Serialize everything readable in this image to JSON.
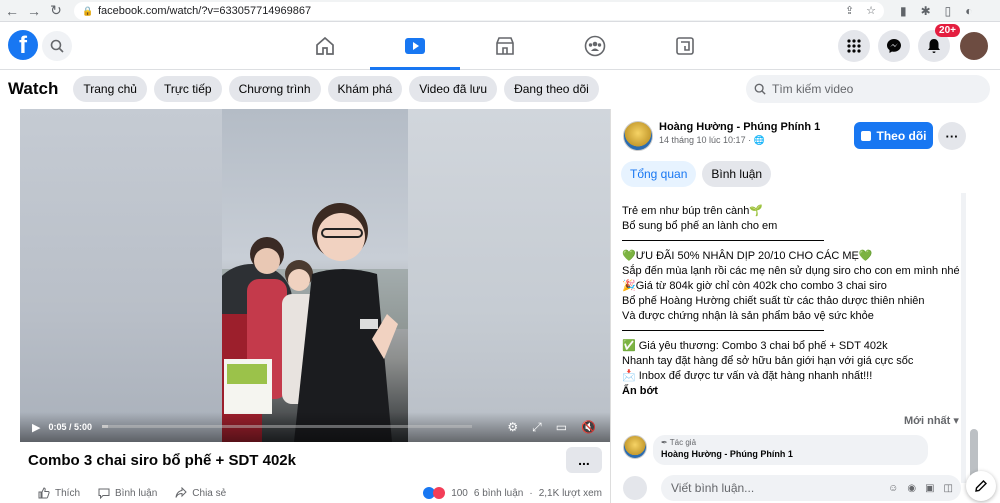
{
  "browser": {
    "url": "facebook.com/watch/?v=633057714969867"
  },
  "header": {
    "notification_badge": "20+"
  },
  "watch": {
    "title": "Watch",
    "tabs": [
      "Trang chủ",
      "Trực tiếp",
      "Chương trình",
      "Khám phá",
      "Video đã lưu",
      "Đang theo dõi"
    ],
    "search_placeholder": "Tìm kiếm video"
  },
  "video": {
    "time": "0:05 / 5:00",
    "progress": 0.017,
    "title": "Combo 3 chai siro bổ phế + SDT 402k",
    "more": "..."
  },
  "actions": {
    "like": "Thích",
    "comment": "Bình luận",
    "share": "Chia sẻ",
    "reactions": "100",
    "comments_count": "6 bình luận",
    "views": "2,1K lượt xem"
  },
  "post": {
    "author": "Hoàng Hường - Phúng Phính 1",
    "time": "14 tháng 10 lúc 10:17 · 🌐",
    "follow": "Theo dõi",
    "tabs": [
      "Tổng quan",
      "Bình luận"
    ],
    "lines_a": [
      "Trẻ em như búp trên cành🌱",
      "Bổ sung bổ phế an lành cho em"
    ],
    "lines_b": [
      "💚ƯU ĐÃI 50% NHÂN DỊP 20/10 CHO CÁC MẸ💚",
      "Sắp đến mùa lạnh rồi các mẹ nên sử dụng siro cho con em mình nhé",
      "🎉Giá từ 804k giờ chỉ còn 402k cho combo 3 chai siro",
      "Bổ phế Hoàng Hường chiết suất từ các thảo dược thiên nhiên",
      "Và được chứng nhận là sản phẩm bảo vệ sức khỏe"
    ],
    "lines_c": [
      "✅ Giá yêu thương: Combo 3 chai bổ phế + SDT 402k",
      "Nhanh tay đặt hàng để sở hữu bản giới hạn với giá cực sốc",
      "📩 Inbox để được tư vấn và đặt hàng nhanh nhất!!!"
    ],
    "see_less": "Ẩn bớt"
  },
  "comments": {
    "sort": "Mới nhất ▾",
    "first": {
      "tag": "✒ Tác giả",
      "name": "Hoàng Hường - Phúng Phính 1"
    },
    "input_placeholder": "Viết bình luận..."
  }
}
